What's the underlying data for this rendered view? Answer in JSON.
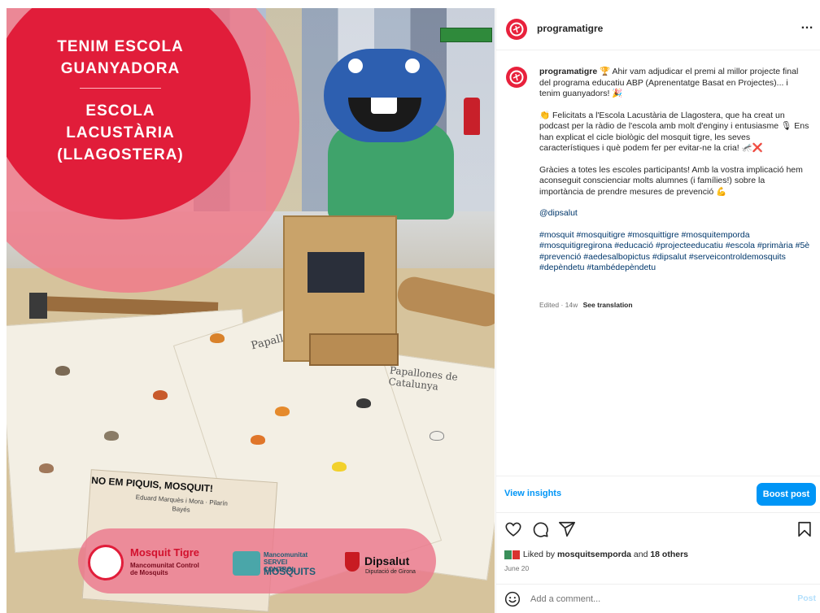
{
  "photo": {
    "badge_title": "TENIM ESCOLA GUANYADORA",
    "badge_subtitle": "ESCOLA LACUSTÀRIA (LLAGOSTERA)",
    "poster_title_1": "Papallones",
    "poster_title_2": "Papallones de Catalunya",
    "book_title": "NO EM PIQUIS, MOSQUIT!",
    "book_authors": "Eduard Marquès i Mora · Pilarín Bayés",
    "sponsor_1_name": "Mosquit Tigre",
    "sponsor_1_sub": "Mancomunitat Control de Mosquits",
    "sponsor_2_top": "Mancomunitat SERVEI CONTROL",
    "sponsor_2_name": "MOSQUITS",
    "sponsor_3_name": "Dipsalut",
    "sponsor_3_sub": "Diputació de Girona"
  },
  "post": {
    "username": "programatigre",
    "more_icon": "…",
    "caption_user": "programatigre",
    "caption_p1": "🏆 Ahir vam adjudicar el premi al millor projecte final del programa educatiu ABP (Aprenentatge Basat en Projectes)... i tenim guanyadors! 🎉",
    "caption_p2": "👏 Felicitats a l'Escola Lacustària de Llagostera, que ha creat un podcast per la ràdio de l'escola amb molt d'enginy i entusiasme 🎙 Ens han explicat el cicle biològic del mosquit tigre, les seves característiques i què podem fer per evitar-ne la cria! 🦟❌",
    "caption_p3": "Gràcies a totes les escoles participants! Amb la vostra implicació hem aconseguit conscienciar molts alumnes (i famílies!) sobre la importància de prendre mesures de prevenció 💪",
    "mention": "@dipsalut",
    "hashtags": "#mosquit #mosquitigre #mosquittigre #mosquitemporda #mosquitigregirona #educació #projecteeducatiu #escola #primària #5è #prevenció #aedesalbopictus #dipsalut #serveicontroldemosquits #depèndetu #tambédepèndetu",
    "edited": "Edited · 14w",
    "see_translation": "See translation",
    "view_insights": "View insights",
    "boost_post": "Boost post",
    "liked_prefix": "Liked by ",
    "liked_user": "mosquitsemporda",
    "liked_and": " and ",
    "liked_others": "18 others",
    "date": "June 20",
    "comment_placeholder": "Add a comment...",
    "post_label": "Post"
  },
  "icons": {
    "heart": "heart-icon",
    "comment": "comment-icon",
    "share": "share-icon",
    "bookmark": "bookmark-icon",
    "emoji": "emoji-icon"
  },
  "colors": {
    "accent": "#0095f6",
    "brand_red": "#e11d3a",
    "link": "#00376b"
  }
}
